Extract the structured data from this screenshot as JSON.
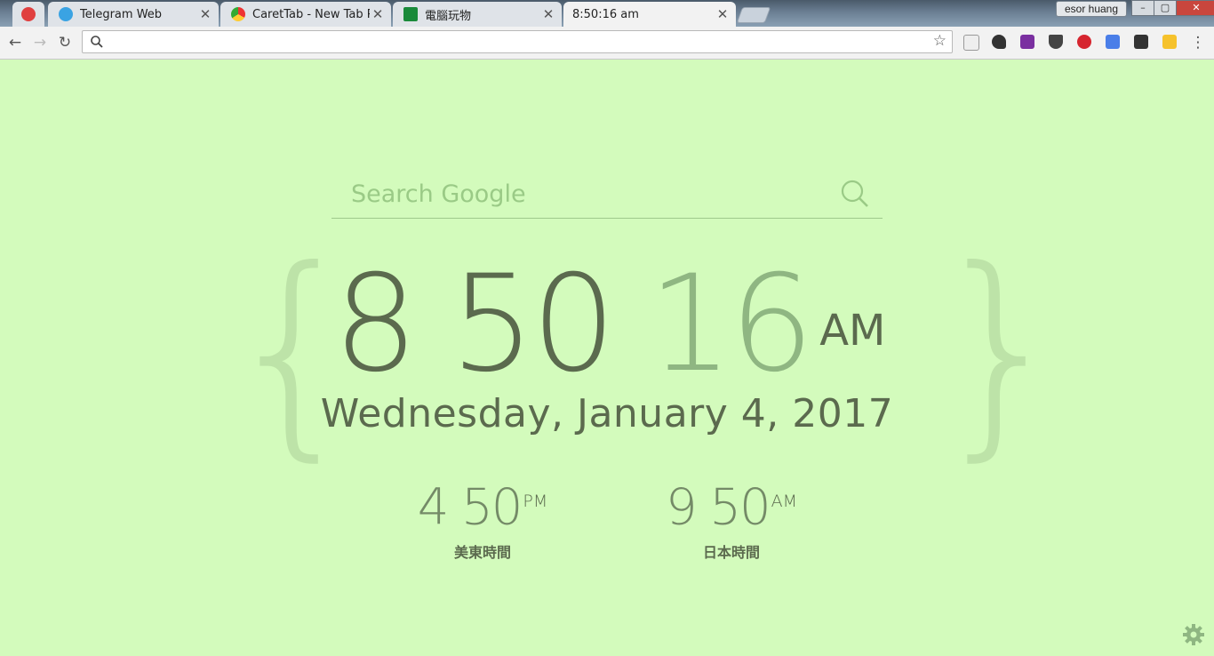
{
  "tabs": [
    {
      "title": "",
      "icon": "power-icon"
    },
    {
      "title": "Telegram Web",
      "icon": "telegram-icon"
    },
    {
      "title": "CaretTab - New Tab Pa",
      "icon": "carettab-icon"
    },
    {
      "title": "電腦玩物",
      "icon": "site-icon"
    },
    {
      "title": "8:50:16 am",
      "icon": ""
    }
  ],
  "profile_name": "esor huang",
  "window_controls": {
    "minimize": "–",
    "maximize": "▢",
    "close": "✕"
  },
  "omnibox": {
    "value": ""
  },
  "search": {
    "placeholder": "Search Google"
  },
  "clock": {
    "hour": "8",
    "minute": "50",
    "second": "16",
    "ampm": "AM"
  },
  "date": "Wednesday, January 4, 2017",
  "zones": [
    {
      "hour": "4",
      "minute": "50",
      "ampm": "PM",
      "label": "美東時間"
    },
    {
      "hour": "9",
      "minute": "50",
      "ampm": "AM",
      "label": "日本時間"
    }
  ],
  "colors": {
    "background": "#d3fbbc",
    "primary": "#5b6a4e",
    "muted": "#8fb682",
    "brace": "#bde3a8"
  }
}
